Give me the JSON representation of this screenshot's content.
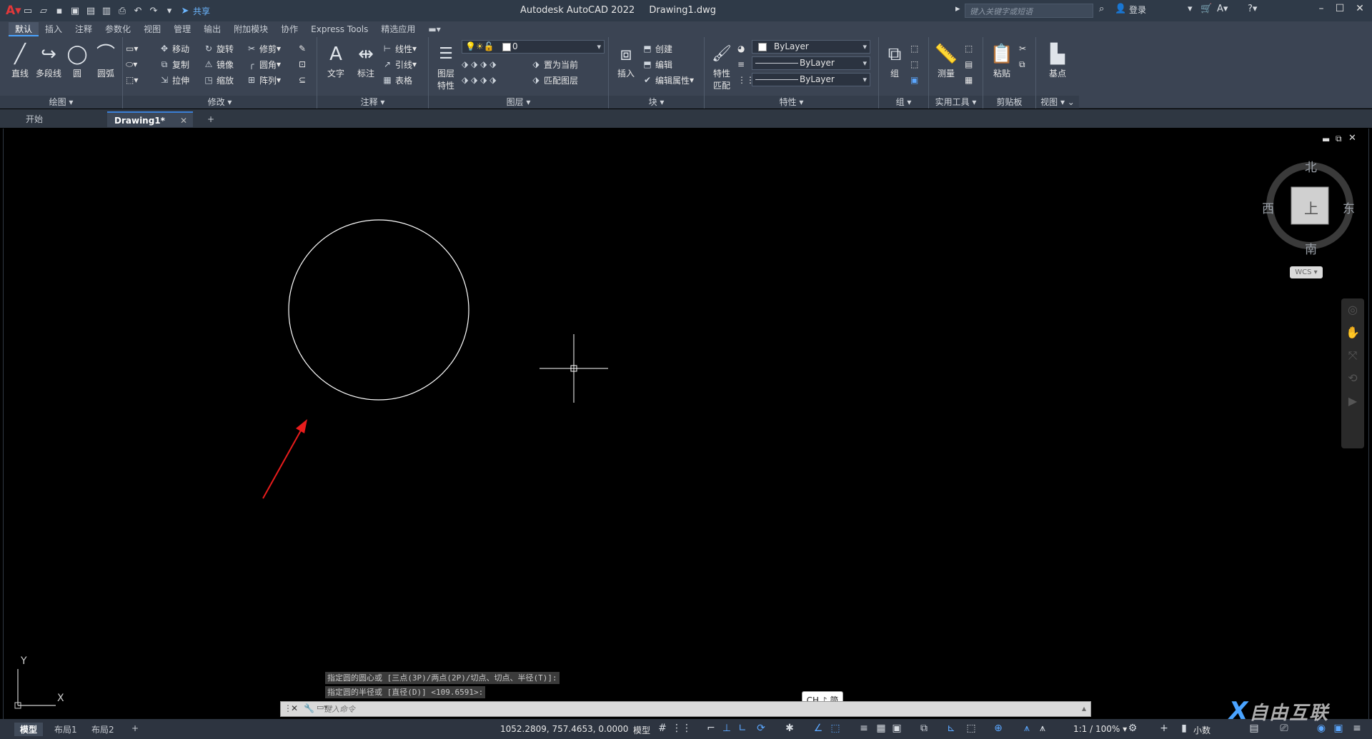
{
  "titlebar": {
    "app_title": "Autodesk AutoCAD 2022",
    "file_name": "Drawing1.dwg",
    "share_label": "共享",
    "search_placeholder": "键入关键字或短语",
    "login_label": "登录"
  },
  "ribbon_tabs": [
    "默认",
    "插入",
    "注释",
    "参数化",
    "视图",
    "管理",
    "输出",
    "附加模块",
    "协作",
    "Express Tools",
    "精选应用"
  ],
  "ribbon": {
    "draw": {
      "title": "绘图",
      "line": "直线",
      "polyline": "多段线",
      "circle": "圆",
      "arc": "圆弧"
    },
    "modify": {
      "title": "修改",
      "move": "移动",
      "rotate": "旋转",
      "trim": "修剪",
      "copy": "复制",
      "mirror": "镜像",
      "fillet": "圆角",
      "stretch": "拉伸",
      "scale": "缩放",
      "array": "阵列"
    },
    "annotation": {
      "title": "注释",
      "text": "文字",
      "dimension": "标注",
      "linear": "线性",
      "leader": "引线",
      "table": "表格"
    },
    "layers": {
      "title": "图层",
      "layer_properties_1": "图层",
      "layer_properties_2": "特性",
      "layer_value": "0",
      "make_current": "置为当前",
      "match_layer": "匹配图层"
    },
    "block": {
      "title": "块",
      "insert": "插入",
      "create": "创建",
      "edit": "编辑",
      "edit_attributes": "编辑属性"
    },
    "properties": {
      "title": "特性",
      "match_1": "特性",
      "match_2": "匹配",
      "color": "ByLayer",
      "linetype": "ByLayer",
      "lineweight": "ByLayer"
    },
    "groups": {
      "title": "组",
      "group": "组"
    },
    "utilities": {
      "title": "实用工具",
      "measure": "测量"
    },
    "clipboard": {
      "title": "剪贴板",
      "paste": "粘贴"
    },
    "view": {
      "title": "视图",
      "base": "基点"
    }
  },
  "doc_tabs": {
    "start": "开始",
    "drawing": "Drawing1*"
  },
  "viewcube": {
    "north": "北",
    "south": "南",
    "east": "东",
    "west": "西",
    "face": "上",
    "wcs": "WCS"
  },
  "ucs": {
    "y": "Y",
    "x": "X"
  },
  "command": {
    "history_1": "指定圆的圆心或 [三点(3P)/两点(2P)/切点、切点、半径(T)]:",
    "history_2": "指定圆的半径或 [直径(D)] <109.6591>:",
    "placeholder": "键入命令",
    "ime": "CH ♪ 简"
  },
  "status": {
    "tabs": [
      "模型",
      "布局1",
      "布局2"
    ],
    "coords": "1052.2809, 757.4653, 0.0000",
    "model": "模型",
    "scale": "1:1 / 100%",
    "units": "小数"
  },
  "watermark": {
    "x": "X",
    "text": "自由互联"
  }
}
